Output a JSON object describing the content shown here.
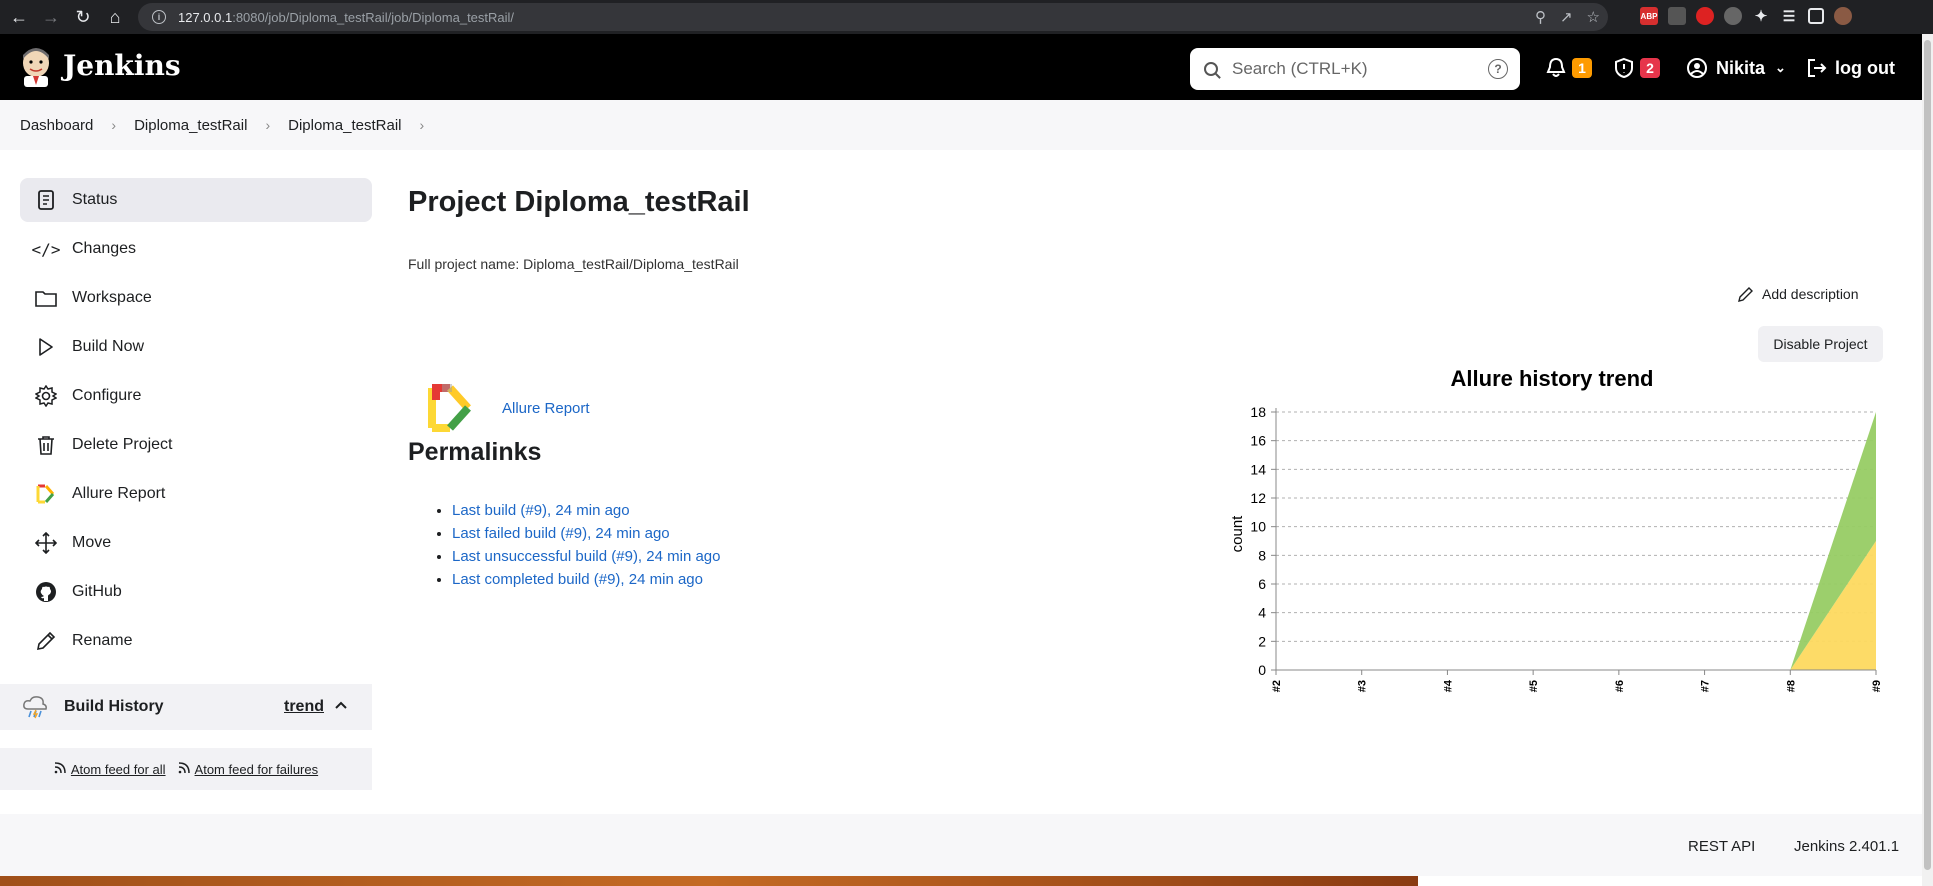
{
  "browser": {
    "url_host": "127.0.0.1",
    "url_rest": ":8080/job/Diploma_testRail/job/Diploma_testRail/"
  },
  "header": {
    "title": "Jenkins",
    "search_placeholder": "Search (CTRL+K)",
    "notifications_count": "1",
    "security_count": "2",
    "user": "Nikita",
    "logout": "log out"
  },
  "breadcrumb": [
    "Dashboard",
    "Diploma_testRail",
    "Diploma_testRail"
  ],
  "sidebar": {
    "items": [
      {
        "label": "Status",
        "icon": "status-icon"
      },
      {
        "label": "Changes",
        "icon": "code-icon"
      },
      {
        "label": "Workspace",
        "icon": "folder-icon"
      },
      {
        "label": "Build Now",
        "icon": "play-icon"
      },
      {
        "label": "Configure",
        "icon": "gear-icon"
      },
      {
        "label": "Delete Project",
        "icon": "trash-icon"
      },
      {
        "label": "Allure Report",
        "icon": "allure-icon"
      },
      {
        "label": "Move",
        "icon": "move-icon"
      },
      {
        "label": "GitHub",
        "icon": "github-icon"
      },
      {
        "label": "Rename",
        "icon": "pencil-icon"
      }
    ],
    "build_history": "Build History",
    "trend": "trend",
    "feed_all": "Atom feed for all",
    "feed_failures": "Atom feed for failures"
  },
  "main": {
    "title": "Project Diploma_testRail",
    "full_name": "Full project name: Diploma_testRail/Diploma_testRail",
    "add_description": "Add description",
    "disable_project": "Disable Project",
    "allure_report": "Allure Report",
    "permalinks_title": "Permalinks",
    "permalinks": [
      "Last build (#9), 24 min ago",
      "Last failed build (#9), 24 min ago",
      "Last unsuccessful build (#9), 24 min ago",
      "Last completed build (#9), 24 min ago"
    ]
  },
  "chart_data": {
    "type": "area",
    "title": "Allure history trend",
    "ylabel": "count",
    "xlabel": "",
    "categories": [
      "#2",
      "#3",
      "#4",
      "#5",
      "#6",
      "#7",
      "#8",
      "#9"
    ],
    "ylim": [
      0,
      18
    ],
    "yticks": [
      0,
      2,
      4,
      6,
      8,
      10,
      12,
      14,
      16,
      18
    ],
    "grid": true,
    "series": [
      {
        "values": [
          0,
          0,
          0,
          0,
          0,
          0,
          0,
          9
        ],
        "color": "#fdd95f"
      },
      {
        "values": [
          0,
          0,
          0,
          0,
          0,
          0,
          0,
          9
        ],
        "color": "#97cc64"
      }
    ]
  },
  "footer": {
    "rest_api": "REST API",
    "version": "Jenkins 2.401.1"
  }
}
